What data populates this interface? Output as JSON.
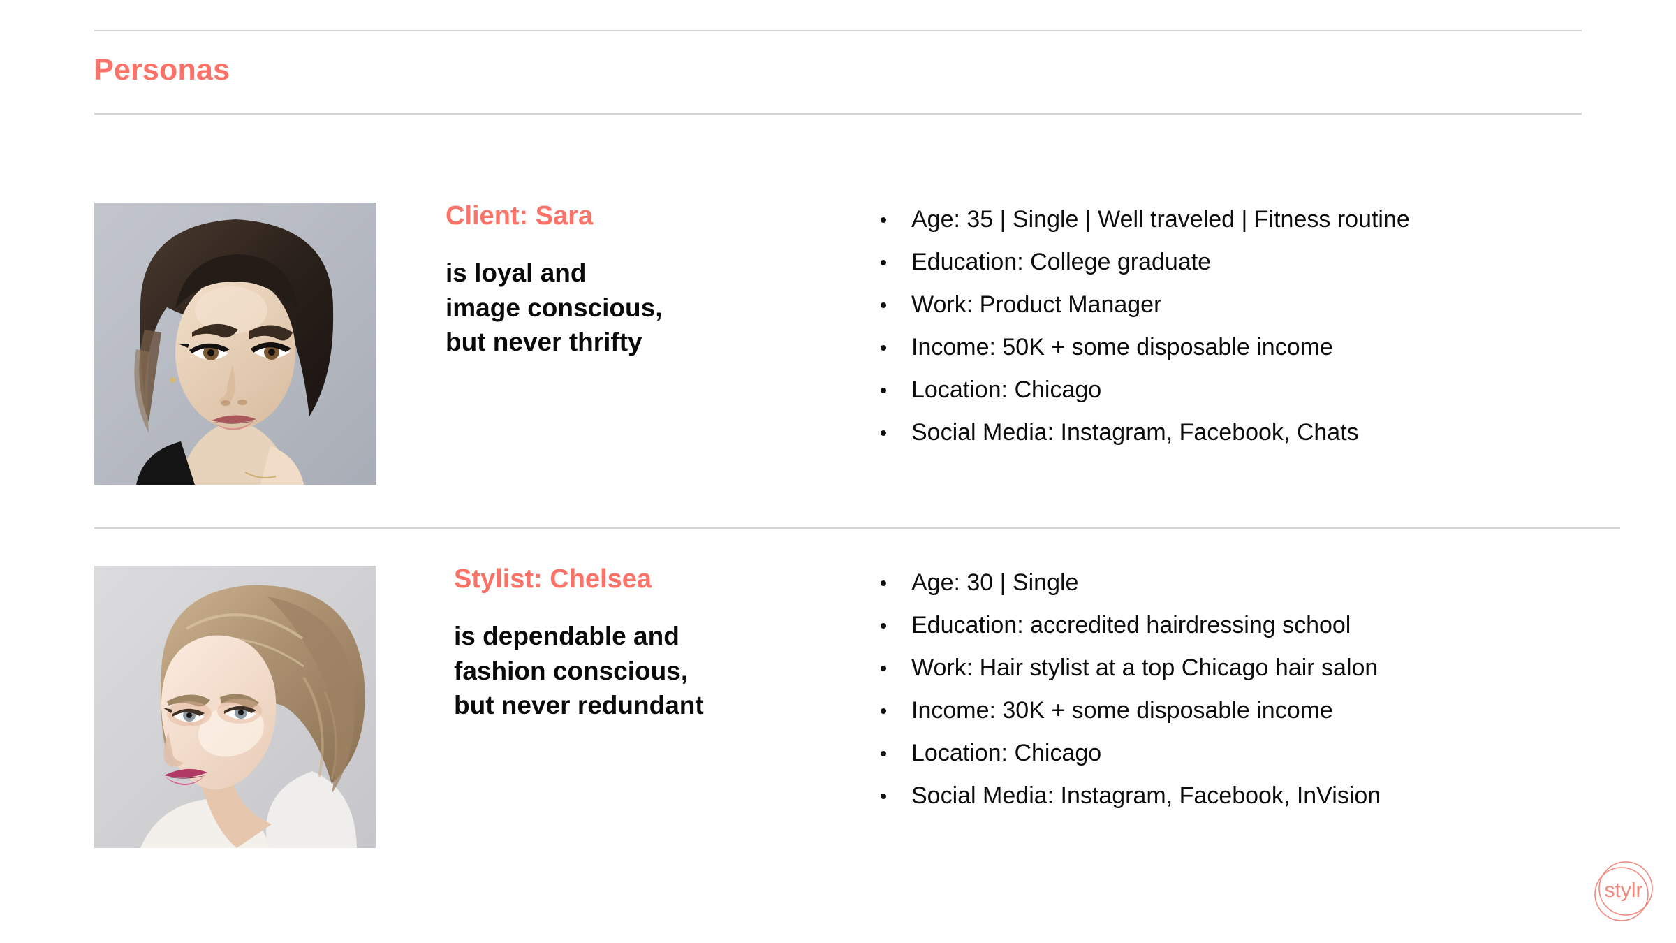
{
  "header": {
    "title": "Personas"
  },
  "personas": [
    {
      "name": "Client: Sara",
      "tagline_lines": [
        "is loyal and",
        "image conscious,",
        "but never thrifty"
      ],
      "photo_alt": "portrait-dark-haired-woman",
      "facts": [
        "Age: 35   |   Single   |   Well traveled   |   Fitness routine",
        "Education: College graduate",
        "Work: Product Manager",
        "Income: 50K + some disposable income",
        "Location: Chicago",
        "Social Media: Instagram, Facebook, Chats"
      ]
    },
    {
      "name": "Stylist: Chelsea",
      "tagline_lines": [
        "is dependable and",
        "fashion conscious,",
        "but never redundant"
      ],
      "photo_alt": "portrait-blonde-woman-profile",
      "facts": [
        "Age: 30   |   Single",
        "Education: accredited hairdressing school",
        "Work: Hair stylist at a top Chicago hair salon",
        "Income: 30K + some disposable income",
        "Location: Chicago",
        "Social Media: Instagram, Facebook, InVision"
      ]
    }
  ],
  "logo": {
    "wordmark": "stylr"
  },
  "colors": {
    "accent": "#fa7268",
    "text": "#0d0d0d",
    "rule": "#d4d4d6",
    "background": "#ffffff"
  }
}
